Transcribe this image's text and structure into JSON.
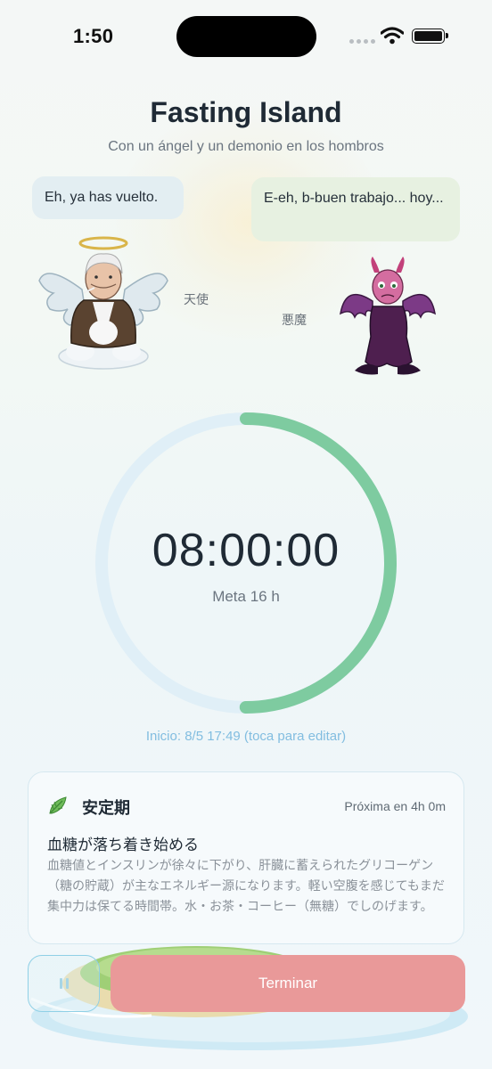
{
  "status_bar": {
    "time": "1:50"
  },
  "header": {
    "title": "Fasting Island",
    "subtitle": "Con un ángel y un demonio en los hombros"
  },
  "characters": {
    "angel": {
      "speech": "Eh, ya has vuelto.",
      "label": "天使",
      "icon": "angel-icon"
    },
    "demon": {
      "speech": "E-eh, b-buen trabajo... hoy...",
      "label": "悪魔",
      "icon": "demon-icon"
    }
  },
  "timer": {
    "elapsed": "08:00:00",
    "goal_label": "Meta 16 h",
    "progress": 0.5,
    "start_info": "Inicio: 8/5 17:49 (toca para editar)",
    "ring_color": "#7ecba0",
    "track_color": "#e0eff7"
  },
  "phase": {
    "icon": "leaf-icon",
    "name": "安定期",
    "next": "Próxima en 4h 0m",
    "headline": "血糖が落ち着き始める",
    "description": "血糖値とインスリンが徐々に下がり、肝臓に蓄えられたグリコーゲン（糖の貯蔵）が主なエネルギー源になります。軽い空腹を感じてもまだ集中力は保てる時間帯。水・お茶・コーヒー（無糖）でしのげます。"
  },
  "actions": {
    "pause_icon": "pause-icon",
    "end_label": "Terminar",
    "end_color": "#e99999"
  }
}
